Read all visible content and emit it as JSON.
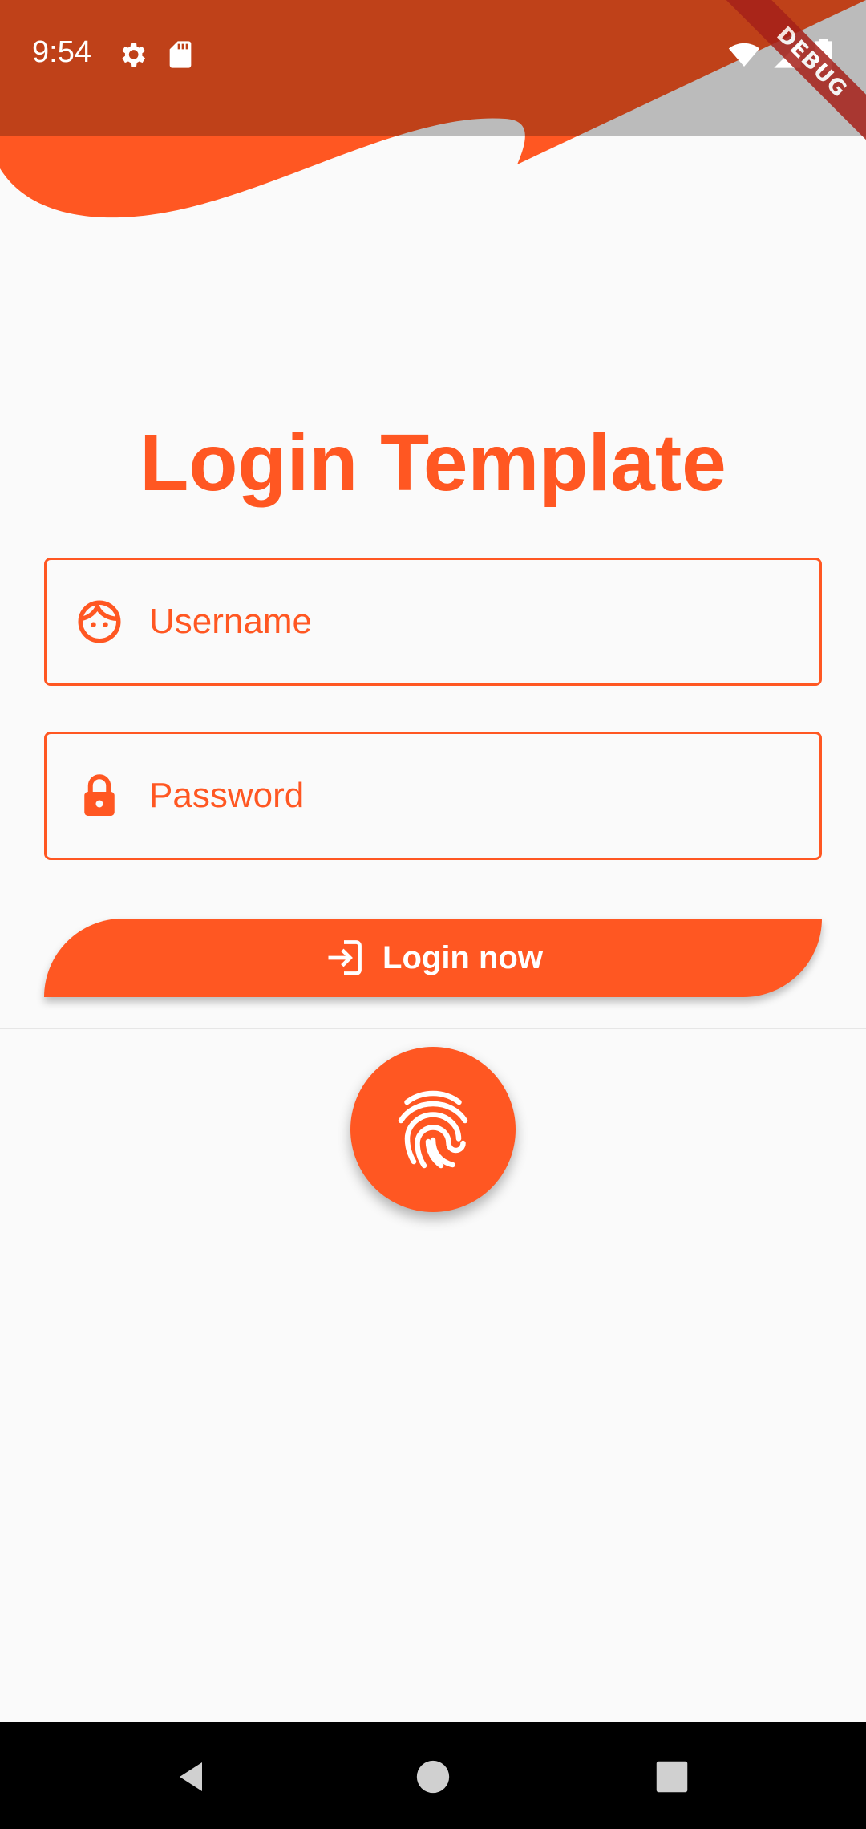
{
  "status_bar": {
    "time": "9:54",
    "left_icons": [
      "gear-icon",
      "sd-card-icon"
    ],
    "right_icons": [
      "wifi-icon",
      "cell-signal-icon",
      "battery-icon"
    ]
  },
  "debug_banner": "DEBUG",
  "header": {
    "title": "Login Template"
  },
  "form": {
    "username": {
      "placeholder": "Username",
      "value": "",
      "icon": "face-icon"
    },
    "password": {
      "placeholder": "Password",
      "value": "",
      "icon": "lock-icon"
    },
    "login_button": {
      "label": "Login now",
      "icon": "login-icon"
    }
  },
  "fingerprint_button": {
    "icon": "fingerprint-icon"
  },
  "navigation": {
    "back": "back-icon",
    "home": "home-icon",
    "recents": "recents-icon"
  },
  "colors": {
    "accent": "#ff5722",
    "header_dark": "#bf360c",
    "background": "#fafafa"
  }
}
